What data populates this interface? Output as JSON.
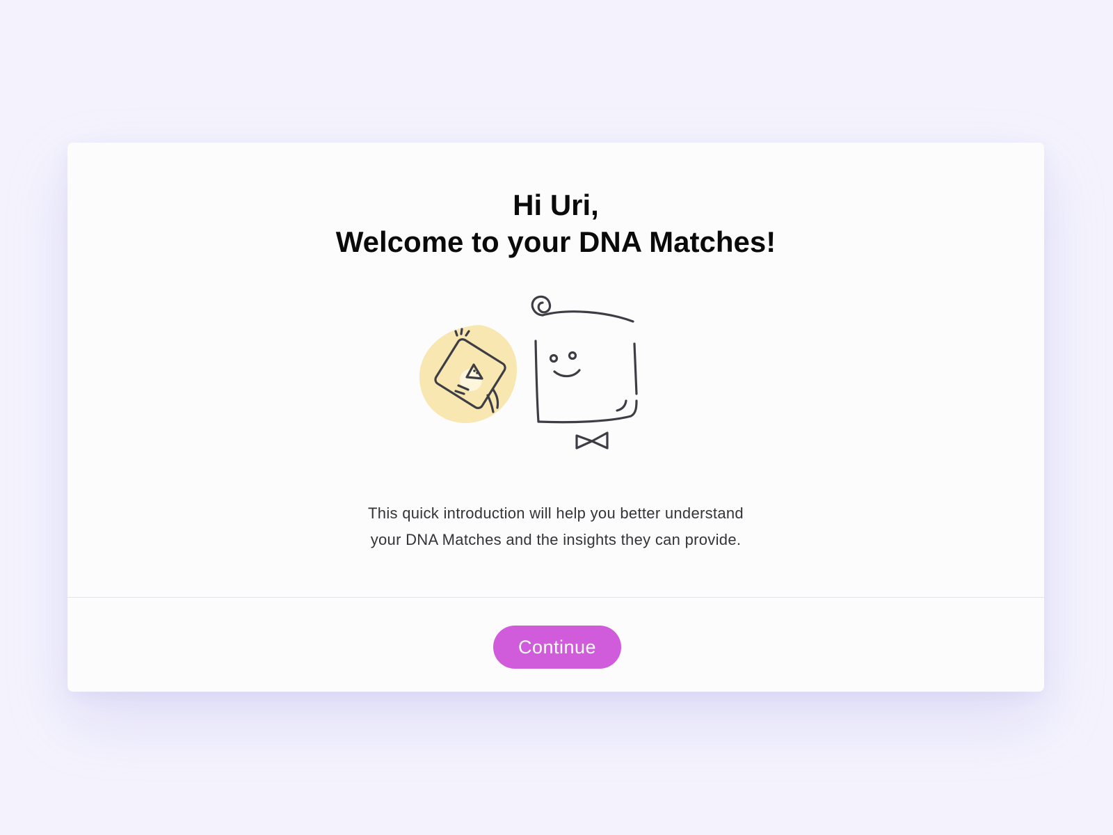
{
  "welcome": {
    "greeting": "Hi Uri,",
    "headline": "Welcome to your DNA Matches!",
    "intro_line_1": "This quick introduction will help you better understand",
    "intro_line_2": "your DNA Matches and the insights they can provide."
  },
  "illustration": {
    "icons": [
      "dna-kit-box-icon",
      "mascot-character-icon"
    ],
    "colors": {
      "highlight_blob": "#f8e7b0",
      "line": "#3d3d45"
    }
  },
  "footer": {
    "continue_label": "Continue"
  },
  "colors": {
    "page_background": "#f4f3fd",
    "card_background": "#fcfcfd",
    "accent": "#d05cdb",
    "divider": "#e4e4ea"
  }
}
